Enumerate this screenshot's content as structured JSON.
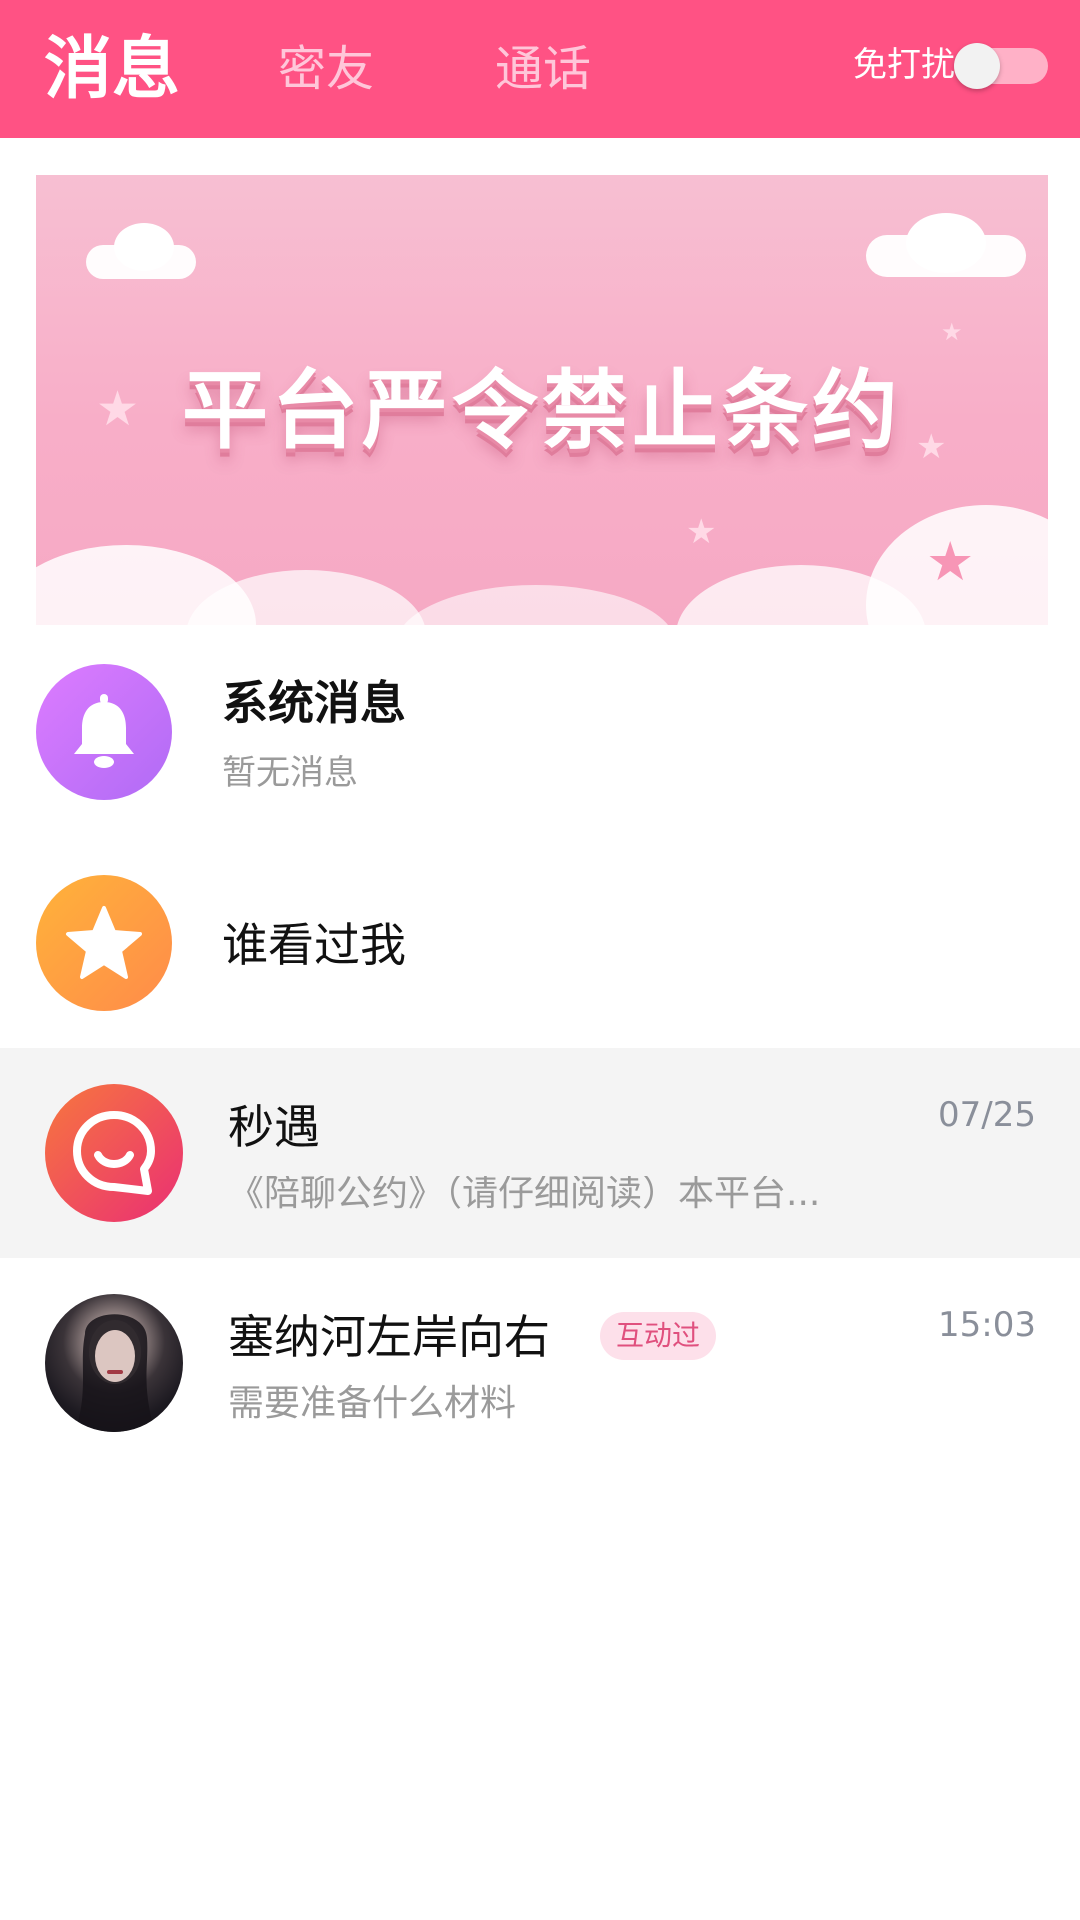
{
  "header": {
    "tabs": [
      {
        "label": "消息",
        "active": true
      },
      {
        "label": "密友",
        "active": false
      },
      {
        "label": "通话",
        "active": false
      }
    ],
    "dnd_label": "免打扰",
    "dnd_on": false,
    "accent": "#ff5284"
  },
  "banner": {
    "title": "平台严令禁止条约"
  },
  "rows": [
    {
      "title": "系统消息",
      "subtitle": "暂无消息",
      "icon": "bell-icon",
      "icon_color": "#c26cf5"
    },
    {
      "title": "谁看过我",
      "icon": "star-icon",
      "icon_color": "#ff9a3d"
    },
    {
      "title": "秒遇",
      "subtitle": "《陪聊公约》（请仔细阅读）本平台...",
      "time": "07/25",
      "icon": "chat-smile-icon",
      "icon_color": "#f04a6a",
      "highlighted": true
    },
    {
      "title": "塞纳河左岸向右",
      "badge": "互动过",
      "subtitle": "需要准备什么材料",
      "time": "15:03",
      "icon": "user-avatar"
    }
  ]
}
